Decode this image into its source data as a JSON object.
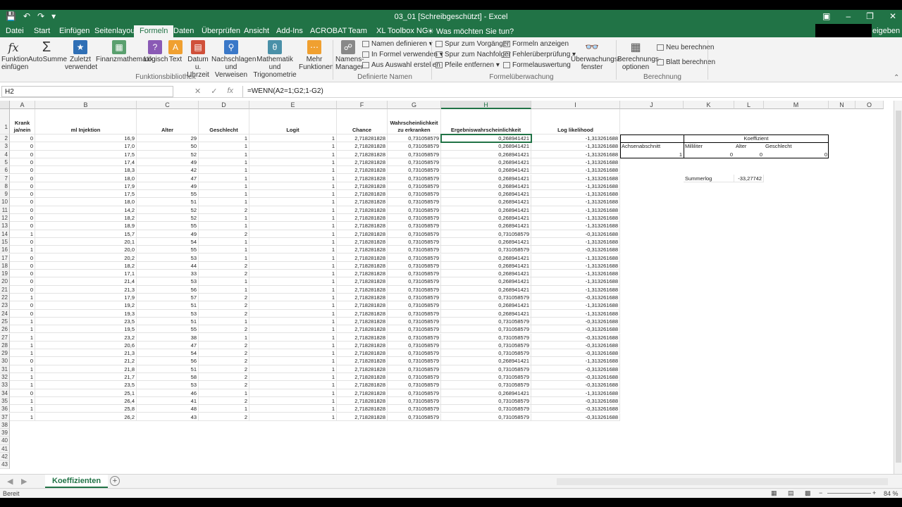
{
  "window": {
    "title": "03_01  [Schreibgeschützt] - Excel",
    "share_label": "eigeben"
  },
  "tabs": [
    "Datei",
    "Start",
    "Einfügen",
    "Seitenlayout",
    "Formeln",
    "Daten",
    "Überprüfen",
    "Ansicht",
    "Add-Ins",
    "ACROBAT",
    "Team",
    "XL Toolbox NG"
  ],
  "active_tab": "Formeln",
  "tell_me": "Was möchten Sie tun?",
  "ribbon": {
    "fx_label": "Funktion einfügen",
    "autosum": "AutoSumme",
    "recent": "Zuletzt verwendet",
    "financial": "Finanzmathematik",
    "logical": "Logisch",
    "text": "Text",
    "datetime": "Datum u. Uhrzeit",
    "lookup": "Nachschlagen und Verweisen",
    "math": "Mathematik und Trigonometrie",
    "more": "Mehr Funktionen",
    "group_functions": "Funktionsbibliothek",
    "name_manager": "Namens-Manager",
    "define_name": "Namen definieren",
    "use_in_formula": "In Formel verwenden",
    "create_from_selection": "Aus Auswahl erstellen",
    "group_names": "Definierte Namen",
    "trace_precedents": "Spur zum Vorgänger",
    "trace_dependents": "Spur zum Nachfolger",
    "remove_arrows": "Pfeile entfernen",
    "show_formulas": "Formeln anzeigen",
    "error_checking": "Fehlerüberprüfung",
    "evaluate": "Formelauswertung",
    "watch_window": "Überwachungs-fenster",
    "group_audit": "Formelüberwachung",
    "calc_options": "Berechnungs-optionen",
    "calc_now": "Neu berechnen",
    "calc_sheet": "Blatt berechnen",
    "group_calc": "Berechnung"
  },
  "formula_bar": {
    "name_box": "H2",
    "formula": "=WENN(A2=1;G2;1-G2)"
  },
  "columns": [
    "A",
    "B",
    "C",
    "D",
    "E",
    "F",
    "G",
    "H",
    "I",
    "J",
    "K",
    "L",
    "M",
    "N",
    "O"
  ],
  "headers": {
    "A": "Krank ja/nein",
    "B": "ml Injektion",
    "C": "Alter",
    "D": "Geschlecht",
    "E": "Logit",
    "F": "Chance",
    "G": "Wahrscheinlichkeit zu erkranken",
    "H": "Ergebniswahrscheinlichkeit",
    "I": "Log likelihood"
  },
  "rows": [
    [
      "0",
      "16,9",
      "29",
      "1",
      "1",
      "2,718281828",
      "0,731058579",
      "0,268941421",
      "-1,313261688"
    ],
    [
      "0",
      "17,0",
      "50",
      "1",
      "1",
      "2,718281828",
      "0,731058579",
      "0,268941421",
      "-1,313261688"
    ],
    [
      "0",
      "17,5",
      "52",
      "1",
      "1",
      "2,718281828",
      "0,731058579",
      "0,268941421",
      "-1,313261688"
    ],
    [
      "0",
      "17,4",
      "49",
      "1",
      "1",
      "2,718281828",
      "0,731058579",
      "0,268941421",
      "-1,313261688"
    ],
    [
      "0",
      "18,3",
      "42",
      "1",
      "1",
      "2,718281828",
      "0,731058579",
      "0,268941421",
      "-1,313261688"
    ],
    [
      "0",
      "18,0",
      "47",
      "1",
      "1",
      "2,718281828",
      "0,731058579",
      "0,268941421",
      "-1,313261688"
    ],
    [
      "0",
      "17,9",
      "49",
      "1",
      "1",
      "2,718281828",
      "0,731058579",
      "0,268941421",
      "-1,313261688"
    ],
    [
      "0",
      "17,5",
      "55",
      "1",
      "1",
      "2,718281828",
      "0,731058579",
      "0,268941421",
      "-1,313261688"
    ],
    [
      "0",
      "18,0",
      "51",
      "1",
      "1",
      "2,718281828",
      "0,731058579",
      "0,268941421",
      "-1,313261688"
    ],
    [
      "0",
      "14,2",
      "52",
      "2",
      "1",
      "2,718281828",
      "0,731058579",
      "0,268941421",
      "-1,313261688"
    ],
    [
      "0",
      "18,2",
      "52",
      "1",
      "1",
      "2,718281828",
      "0,731058579",
      "0,268941421",
      "-1,313261688"
    ],
    [
      "0",
      "18,9",
      "55",
      "1",
      "1",
      "2,718281828",
      "0,731058579",
      "0,268941421",
      "-1,313261688"
    ],
    [
      "1",
      "15,7",
      "49",
      "2",
      "1",
      "2,718281828",
      "0,731058579",
      "0,731058579",
      "-0,313261688"
    ],
    [
      "0",
      "20,1",
      "54",
      "1",
      "1",
      "2,718281828",
      "0,731058579",
      "0,268941421",
      "-1,313261688"
    ],
    [
      "1",
      "20,0",
      "55",
      "1",
      "1",
      "2,718281828",
      "0,731058579",
      "0,731058579",
      "-0,313261688"
    ],
    [
      "0",
      "20,2",
      "53",
      "1",
      "1",
      "2,718281828",
      "0,731058579",
      "0,268941421",
      "-1,313261688"
    ],
    [
      "0",
      "18,2",
      "44",
      "2",
      "1",
      "2,718281828",
      "0,731058579",
      "0,268941421",
      "-1,313261688"
    ],
    [
      "0",
      "17,1",
      "33",
      "2",
      "1",
      "2,718281828",
      "0,731058579",
      "0,268941421",
      "-1,313261688"
    ],
    [
      "0",
      "21,4",
      "53",
      "1",
      "1",
      "2,718281828",
      "0,731058579",
      "0,268941421",
      "-1,313261688"
    ],
    [
      "0",
      "21,3",
      "56",
      "1",
      "1",
      "2,718281828",
      "0,731058579",
      "0,268941421",
      "-1,313261688"
    ],
    [
      "1",
      "17,9",
      "57",
      "2",
      "1",
      "2,718281828",
      "0,731058579",
      "0,731058579",
      "-0,313261688"
    ],
    [
      "0",
      "19,2",
      "51",
      "2",
      "1",
      "2,718281828",
      "0,731058579",
      "0,268941421",
      "-1,313261688"
    ],
    [
      "0",
      "19,3",
      "53",
      "2",
      "1",
      "2,718281828",
      "0,731058579",
      "0,268941421",
      "-1,313261688"
    ],
    [
      "1",
      "23,5",
      "51",
      "1",
      "1",
      "2,718281828",
      "0,731058579",
      "0,731058579",
      "-0,313261688"
    ],
    [
      "1",
      "19,5",
      "55",
      "2",
      "1",
      "2,718281828",
      "0,731058579",
      "0,731058579",
      "-0,313261688"
    ],
    [
      "1",
      "23,2",
      "38",
      "1",
      "1",
      "2,718281828",
      "0,731058579",
      "0,731058579",
      "-0,313261688"
    ],
    [
      "1",
      "20,6",
      "47",
      "2",
      "1",
      "2,718281828",
      "0,731058579",
      "0,731058579",
      "-0,313261688"
    ],
    [
      "1",
      "21,3",
      "54",
      "2",
      "1",
      "2,718281828",
      "0,731058579",
      "0,731058579",
      "-0,313261688"
    ],
    [
      "0",
      "21,2",
      "56",
      "2",
      "1",
      "2,718281828",
      "0,731058579",
      "0,268941421",
      "-1,313261688"
    ],
    [
      "1",
      "21,8",
      "51",
      "2",
      "1",
      "2,718281828",
      "0,731058579",
      "0,731058579",
      "-0,313261688"
    ],
    [
      "1",
      "21,7",
      "58",
      "2",
      "1",
      "2,718281828",
      "0,731058579",
      "0,731058579",
      "-0,313261688"
    ],
    [
      "1",
      "23,5",
      "53",
      "2",
      "1",
      "2,718281828",
      "0,731058579",
      "0,731058579",
      "-0,313261688"
    ],
    [
      "0",
      "25,1",
      "46",
      "1",
      "1",
      "2,718281828",
      "0,731058579",
      "0,268941421",
      "-1,313261688"
    ],
    [
      "1",
      "26,4",
      "41",
      "2",
      "1",
      "2,718281828",
      "0,731058579",
      "0,731058579",
      "-0,313261688"
    ],
    [
      "1",
      "25,8",
      "48",
      "1",
      "1",
      "2,718281828",
      "0,731058579",
      "0,731058579",
      "-0,313261688"
    ],
    [
      "1",
      "26,2",
      "43",
      "2",
      "1",
      "2,718281828",
      "0,731058579",
      "0,731058579",
      "-0,313261688"
    ]
  ],
  "coef": {
    "title": "Koeffizient",
    "labels": [
      "Achsenabschnitt",
      "Milliliter",
      "Alter",
      "Geschlecht"
    ],
    "values": [
      "1",
      "0",
      "0",
      "0"
    ],
    "summer_label": "Summerlog",
    "summer_value": "-33,27742"
  },
  "sheet_tab": "Koeffizienten",
  "status": {
    "ready": "Bereit",
    "zoom": "84 %"
  }
}
